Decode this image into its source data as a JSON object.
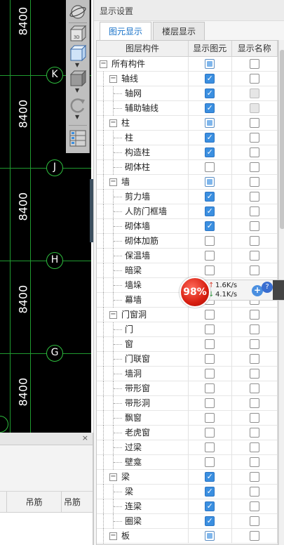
{
  "cad": {
    "dimensions": [
      "8400",
      "8400",
      "8400",
      "8400",
      "8400"
    ],
    "axes": [
      {
        "label": "K"
      },
      {
        "label": "J"
      },
      {
        "label": "H"
      },
      {
        "label": "G"
      }
    ],
    "view_tools": [
      "orbit-icon",
      "3d-view-icon",
      "wireframe-box-icon",
      "solid-box-icon",
      "rotate-icon",
      "batch-select-icon"
    ]
  },
  "bottom_panel": {
    "columns": [
      "吊筋",
      "吊筋"
    ],
    "close": "×"
  },
  "settings": {
    "title": "显示设置",
    "tabs": [
      {
        "label": "图元显示",
        "active": true
      },
      {
        "label": "楼层显示",
        "active": false
      }
    ],
    "headers": {
      "component": "图层构件",
      "show_element": "显示图元",
      "show_name": "显示名称"
    },
    "rows": [
      {
        "label": "所有构件",
        "level": 0,
        "expander": "−",
        "el": "partial",
        "name": "unchecked"
      },
      {
        "label": "轴线",
        "level": 1,
        "expander": "−",
        "el": "checked",
        "name": "unchecked"
      },
      {
        "label": "轴网",
        "level": 2,
        "el": "checked",
        "name": "disabled"
      },
      {
        "label": "辅助轴线",
        "level": 2,
        "el": "checked",
        "name": "disabled"
      },
      {
        "label": "柱",
        "level": 1,
        "expander": "−",
        "el": "partial",
        "name": "unchecked"
      },
      {
        "label": "柱",
        "level": 2,
        "el": "checked",
        "name": "unchecked"
      },
      {
        "label": "构造柱",
        "level": 2,
        "el": "checked",
        "name": "unchecked"
      },
      {
        "label": "砌体柱",
        "level": 2,
        "el": "unchecked",
        "name": "unchecked"
      },
      {
        "label": "墙",
        "level": 1,
        "expander": "−",
        "el": "partial",
        "name": "unchecked"
      },
      {
        "label": "剪力墙",
        "level": 2,
        "el": "checked",
        "name": "unchecked"
      },
      {
        "label": "人防门框墙",
        "level": 2,
        "el": "checked",
        "name": "unchecked"
      },
      {
        "label": "砌体墙",
        "level": 2,
        "el": "checked",
        "name": "unchecked"
      },
      {
        "label": "砌体加筋",
        "level": 2,
        "el": "unchecked",
        "name": "unchecked"
      },
      {
        "label": "保温墙",
        "level": 2,
        "el": "unchecked",
        "name": "unchecked"
      },
      {
        "label": "暗梁",
        "level": 2,
        "el": "unchecked",
        "name": "unchecked"
      },
      {
        "label": "墙垛",
        "level": 2,
        "el": "unchecked",
        "name": "unchecked"
      },
      {
        "label": "幕墙",
        "level": 2,
        "el": "unchecked",
        "name": "unchecked"
      },
      {
        "label": "门窗洞",
        "level": 1,
        "expander": "−",
        "el": "unchecked",
        "name": "unchecked"
      },
      {
        "label": "门",
        "level": 2,
        "el": "unchecked",
        "name": "unchecked"
      },
      {
        "label": "窗",
        "level": 2,
        "el": "unchecked",
        "name": "unchecked"
      },
      {
        "label": "门联窗",
        "level": 2,
        "el": "unchecked",
        "name": "unchecked"
      },
      {
        "label": "墙洞",
        "level": 2,
        "el": "unchecked",
        "name": "unchecked"
      },
      {
        "label": "带形窗",
        "level": 2,
        "el": "unchecked",
        "name": "unchecked"
      },
      {
        "label": "带形洞",
        "level": 2,
        "el": "unchecked",
        "name": "unchecked"
      },
      {
        "label": "飘窗",
        "level": 2,
        "el": "unchecked",
        "name": "unchecked"
      },
      {
        "label": "老虎窗",
        "level": 2,
        "el": "unchecked",
        "name": "unchecked"
      },
      {
        "label": "过梁",
        "level": 2,
        "el": "unchecked",
        "name": "unchecked"
      },
      {
        "label": "壁龛",
        "level": 2,
        "el": "unchecked",
        "name": "unchecked"
      },
      {
        "label": "梁",
        "level": 1,
        "expander": "−",
        "el": "checked",
        "name": "unchecked"
      },
      {
        "label": "梁",
        "level": 2,
        "el": "checked",
        "name": "unchecked"
      },
      {
        "label": "连梁",
        "level": 2,
        "el": "checked",
        "name": "unchecked"
      },
      {
        "label": "圈梁",
        "level": 2,
        "el": "checked",
        "name": "unchecked"
      },
      {
        "label": "板",
        "level": 1,
        "expander": "−",
        "el": "partial",
        "name": "unchecked"
      }
    ]
  },
  "net_widget": {
    "percent": "98%",
    "upload": "1.6K/s",
    "download": "4.1K/s",
    "plus": "+",
    "help": "?"
  },
  "colors": {
    "accent": "#3b8fe0",
    "tab_active_text": "#1a73c9",
    "cad_background": "#000000",
    "grid_line": "#1f9a2f",
    "net_ball": "#d81e10"
  }
}
